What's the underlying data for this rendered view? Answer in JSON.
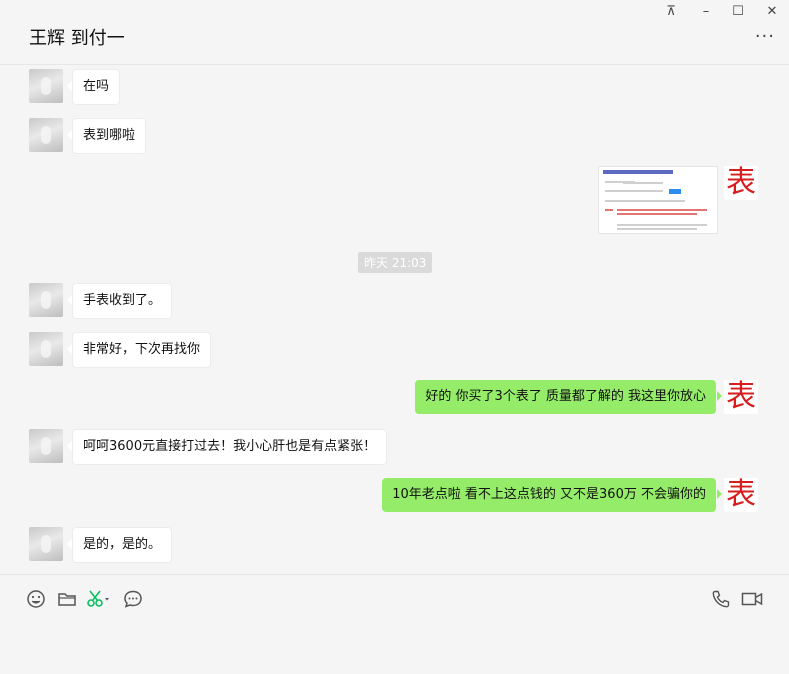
{
  "window": {
    "title": "王辉 到付一",
    "controls": {
      "pin": "⊼",
      "minimize": "–",
      "maximize": "☐",
      "close": "✕"
    },
    "more": "···"
  },
  "messages": [
    {
      "side": "in",
      "text": "在吗"
    },
    {
      "side": "in",
      "text": "表到哪啦"
    },
    {
      "side": "out",
      "type": "image"
    },
    {
      "side": "in",
      "text": "手表收到了。"
    },
    {
      "side": "in",
      "text": "非常好，下次再找你"
    },
    {
      "side": "out",
      "text": "好的  你买了3个表了  质量都了解的   我这里你放心"
    },
    {
      "side": "in",
      "text": "呵呵3600元直接打过去！我小心肝也是有点紧张！"
    },
    {
      "side": "out",
      "text": "10年老点啦  看不上这点钱的  又不是360万  不会骗你的"
    },
    {
      "side": "in",
      "text": "是的，是的。"
    }
  ],
  "timestamp": "昨天 21:03",
  "self_avatar_char": "表",
  "toolbar": {
    "left_icons": [
      "emoji-icon",
      "folder-icon",
      "scissors-icon",
      "chat-history-icon"
    ],
    "right_icons": [
      "phone-icon",
      "video-icon"
    ]
  },
  "colors": {
    "out_bubble": "#95ec69",
    "in_bubble": "#ffffff",
    "accent_green": "#07c160",
    "avatar_char": "#d71d1d"
  }
}
